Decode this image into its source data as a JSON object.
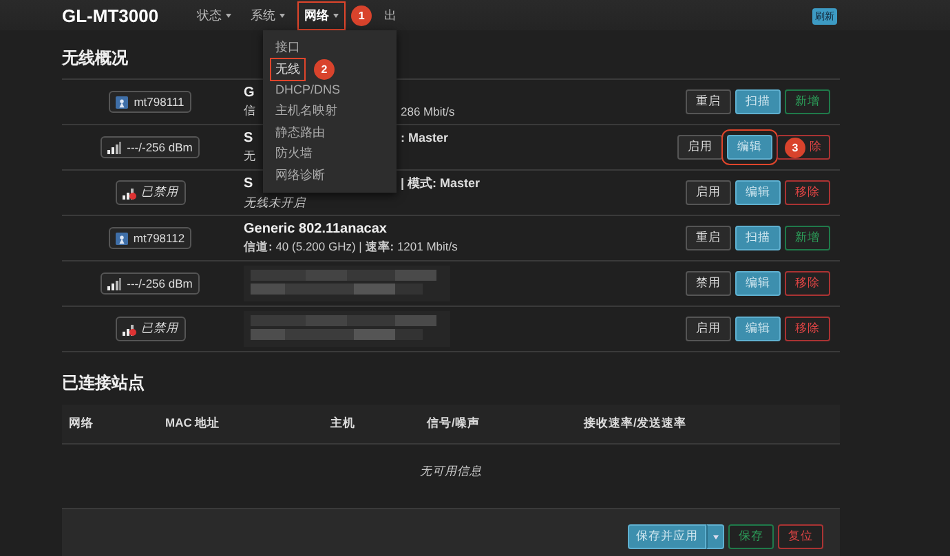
{
  "header": {
    "brand": "GL-MT3000",
    "nav": [
      {
        "label": "状态",
        "dropdown": true,
        "selected": false,
        "outlined": false
      },
      {
        "label": "系统",
        "dropdown": true,
        "selected": false,
        "outlined": false
      },
      {
        "label": "网络",
        "dropdown": true,
        "selected": true,
        "outlined": true,
        "callout": "1"
      },
      {
        "label": "出",
        "dropdown": false,
        "selected": false,
        "outlined": false
      }
    ],
    "badge": "刷新"
  },
  "menu": {
    "items": [
      {
        "label": "接口",
        "selected": false,
        "outlined": false
      },
      {
        "label": "无线",
        "selected": true,
        "outlined": true,
        "callout": "2"
      },
      {
        "label": "DHCP/DNS",
        "selected": false,
        "outlined": false
      },
      {
        "label": "主机名映射",
        "selected": false,
        "outlined": false
      },
      {
        "label": "静态路由",
        "selected": false,
        "outlined": false
      },
      {
        "label": "防火墙",
        "selected": false,
        "outlined": false
      },
      {
        "label": "网络诊断",
        "selected": false,
        "outlined": false
      }
    ]
  },
  "wireless": {
    "title": "无线概况",
    "rows": [
      {
        "badge": {
          "kind": "radio",
          "text": "mt798111"
        },
        "line1": "G",
        "line2": "信",
        "line2_tail": "286 Mbit/s",
        "buttons": [
          {
            "label": "重启",
            "kind": "default",
            "outlined": false
          },
          {
            "label": "扫描",
            "kind": "primary",
            "outlined": false
          },
          {
            "label": "新增",
            "kind": "positive",
            "outlined": false
          }
        ]
      },
      {
        "badge": {
          "kind": "signal",
          "text": "---/-256 dBm"
        },
        "line1": "S",
        "line1_tail": ": Master",
        "line2": "无",
        "buttons": [
          {
            "label": "启用",
            "kind": "default",
            "outlined": false
          },
          {
            "label": "编辑",
            "kind": "primary",
            "outlined": true
          },
          {
            "label": "除",
            "kind": "negative",
            "outlined": false,
            "callout": "3"
          }
        ]
      },
      {
        "badge": {
          "kind": "disabled",
          "text": "已禁用"
        },
        "line1": "S",
        "line1_tail": "| **模式:** Master",
        "line2": "无线未开启",
        "buttons": [
          {
            "label": "启用",
            "kind": "default",
            "outlined": false
          },
          {
            "label": "编辑",
            "kind": "primary",
            "outlined": false
          },
          {
            "label": "移除",
            "kind": "negative",
            "outlined": false
          }
        ]
      },
      {
        "badge": {
          "kind": "radio",
          "text": "mt798112"
        },
        "line1": "Generic 802.11anacax",
        "line2": "**信道:** 40 (5.200 GHz) | **速率:** 1201 Mbit/s",
        "buttons": [
          {
            "label": "重启",
            "kind": "default",
            "outlined": false
          },
          {
            "label": "扫描",
            "kind": "primary",
            "outlined": false
          },
          {
            "label": "新增",
            "kind": "positive",
            "outlined": false
          }
        ]
      },
      {
        "badge": {
          "kind": "signal",
          "text": "---/-256 dBm"
        },
        "info": {
          "kind": "picture"
        },
        "buttons": [
          {
            "label": "禁用",
            "kind": "default",
            "outlined": false
          },
          {
            "label": "编辑",
            "kind": "primary",
            "outlined": false
          },
          {
            "label": "移除",
            "kind": "negative",
            "outlined": false
          }
        ]
      },
      {
        "badge": {
          "kind": "disabled",
          "text": "已禁用"
        },
        "info": {
          "kind": "picture"
        },
        "buttons": [
          {
            "label": "启用",
            "kind": "default",
            "outlined": false
          },
          {
            "label": "编辑",
            "kind": "primary",
            "outlined": false
          },
          {
            "label": "移除",
            "kind": "negative",
            "outlined": false
          }
        ]
      }
    ]
  },
  "stations": {
    "title": "已连接站点",
    "columns": [
      "网络",
      "MAC 地址",
      "主机",
      "信号/噪声",
      "接收速率/发送速率"
    ],
    "empty": "无可用信息"
  },
  "footer": {
    "buttons": [
      {
        "label": "保存并应用",
        "kind": "primary",
        "split": true
      },
      {
        "label": "保存",
        "kind": "positive",
        "split": false
      },
      {
        "label": "复位",
        "kind": "negative",
        "split": false
      }
    ]
  }
}
